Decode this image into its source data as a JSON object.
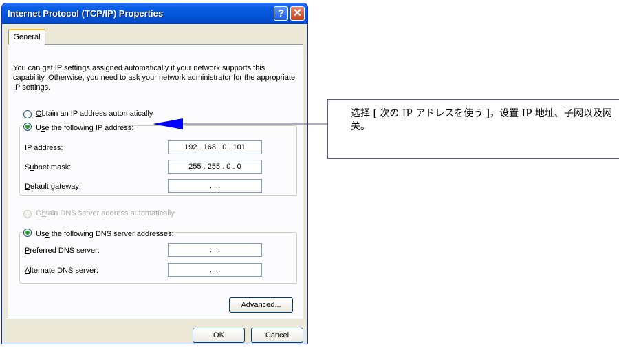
{
  "dialog": {
    "title": "Internet Protocol (TCP/IP) Properties",
    "help_glyph": "?",
    "close_glyph": "✕",
    "tab_general": "General",
    "description": "You can get IP settings assigned automatically if your network supports this capability. Otherwise, you need to ask your network administrator for the appropriate IP settings.",
    "ip": {
      "auto_label": "Obtain an IP address automatically",
      "manual_label": "Use the following IP address:",
      "ip_address_label": "IP address:",
      "ip_address_value": "192 . 168 .  0  . 101",
      "subnet_label": "Subnet mask:",
      "subnet_value": "255 . 255 .  0  .  0",
      "gateway_label": "Default gateway:",
      "gateway_value": ".       .       ."
    },
    "dns": {
      "auto_label": "Obtain DNS server address automatically",
      "manual_label": "Use the following DNS server addresses:",
      "preferred_label": "Preferred DNS server:",
      "preferred_value": ".       .       .",
      "alternate_label": "Alternate DNS server:",
      "alternate_value": ".       .       ."
    },
    "advanced_label": "Advanced...",
    "ok_label": "OK",
    "cancel_label": "Cancel"
  },
  "callout": {
    "text": "选择 [ 次の IP アドレスを使う ]，设置 IP 地址、子网以及网关。"
  },
  "colors": {
    "titlebar": "#0454d8",
    "dialog_bg": "#ece9d8",
    "radio_selected": "#21a121",
    "callout_arrow": "#0000ff"
  }
}
